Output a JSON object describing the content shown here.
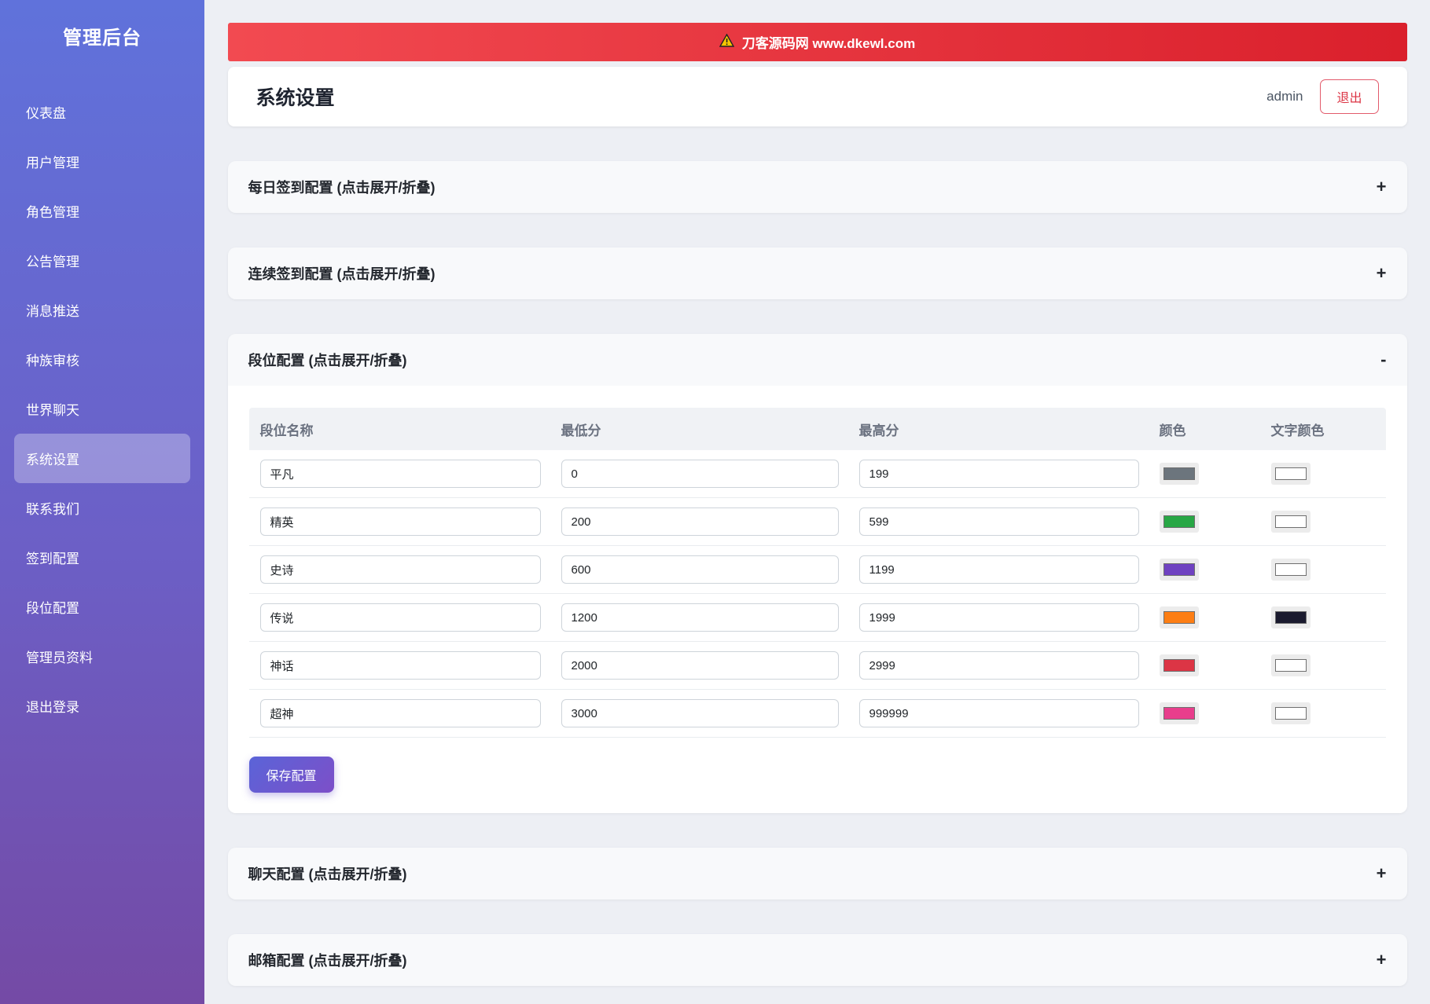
{
  "sidebar": {
    "title": "管理后台",
    "items": [
      {
        "label": "仪表盘",
        "active": false
      },
      {
        "label": "用户管理",
        "active": false
      },
      {
        "label": "角色管理",
        "active": false
      },
      {
        "label": "公告管理",
        "active": false
      },
      {
        "label": "消息推送",
        "active": false
      },
      {
        "label": "种族审核",
        "active": false
      },
      {
        "label": "世界聊天",
        "active": false
      },
      {
        "label": "系统设置",
        "active": true
      },
      {
        "label": "联系我们",
        "active": false
      },
      {
        "label": "签到配置",
        "active": false
      },
      {
        "label": "段位配置",
        "active": false
      },
      {
        "label": "管理员资料",
        "active": false
      },
      {
        "label": "退出登录",
        "active": false
      }
    ]
  },
  "banner": {
    "icon": "warning-triangle",
    "text": "刀客源码网 www.dkewl.com",
    "background": "#e1252f",
    "icon_color": "#f6c500"
  },
  "header": {
    "title": "系统设置",
    "username": "admin",
    "logout_label": "退出",
    "logout_color": "#dc3545"
  },
  "sections": [
    {
      "title": "每日签到配置 (点击展开/折叠)",
      "toggle": "+",
      "expanded": false
    },
    {
      "title": "连续签到配置 (点击展开/折叠)",
      "toggle": "+",
      "expanded": false
    },
    {
      "title": "段位配置 (点击展开/折叠)",
      "toggle": "-",
      "expanded": true
    },
    {
      "title": "聊天配置 (点击展开/折叠)",
      "toggle": "+",
      "expanded": false
    },
    {
      "title": "邮箱配置 (点击展开/折叠)",
      "toggle": "+",
      "expanded": false
    }
  ],
  "rank_table": {
    "columns": [
      "段位名称",
      "最低分",
      "最高分",
      "颜色",
      "文字颜色"
    ],
    "rows": [
      {
        "name": "平凡",
        "min": "0",
        "max": "199",
        "color": "#6c757d",
        "text_color": "#ffffff"
      },
      {
        "name": "精英",
        "min": "200",
        "max": "599",
        "color": "#28a745",
        "text_color": "#ffffff"
      },
      {
        "name": "史诗",
        "min": "600",
        "max": "1199",
        "color": "#6f42c1",
        "text_color": "#ffffff"
      },
      {
        "name": "传说",
        "min": "1200",
        "max": "1999",
        "color": "#fd7e14",
        "text_color": "#1a1a2e"
      },
      {
        "name": "神话",
        "min": "2000",
        "max": "2999",
        "color": "#dc3545",
        "text_color": "#ffffff"
      },
      {
        "name": "超神",
        "min": "3000",
        "max": "999999",
        "color": "#e83e8c",
        "text_color": "#ffffff"
      }
    ],
    "save_label": "保存配置"
  }
}
